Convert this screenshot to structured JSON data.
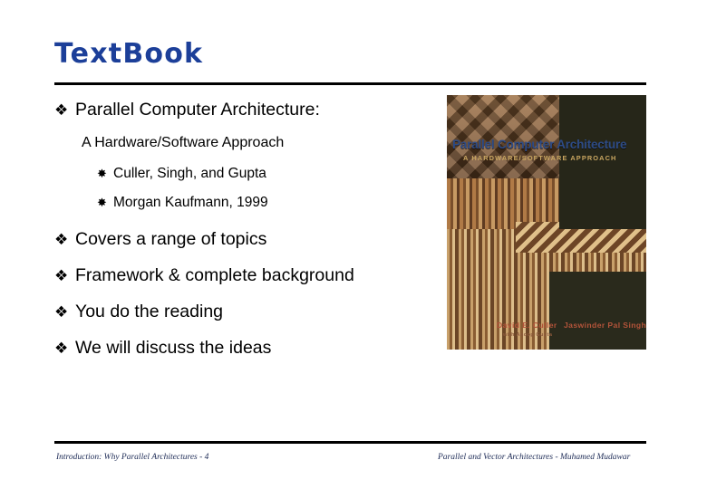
{
  "slide": {
    "title": "TextBook",
    "title_color": "#1c3f99"
  },
  "body": {
    "items": [
      {
        "level": 1,
        "glyph": "❖",
        "text": "Parallel Computer Architecture:"
      },
      {
        "level": 2,
        "glyph": "",
        "text": "A Hardware/Software Approach"
      },
      {
        "level": 3,
        "glyph": "✸",
        "text": "Culler, Singh, and Gupta"
      },
      {
        "level": 3,
        "glyph": "✸",
        "text": "Morgan Kaufmann, 1999"
      },
      {
        "level": 1,
        "glyph": "❖",
        "text": "Covers a range of topics"
      },
      {
        "level": 1,
        "glyph": "❖",
        "text": "Framework & complete background"
      },
      {
        "level": 1,
        "glyph": "❖",
        "text": "You do the reading"
      },
      {
        "level": 1,
        "glyph": "❖",
        "text": "We will discuss the ideas"
      }
    ]
  },
  "book_cover": {
    "title": "Parallel Computer Architecture",
    "subtitle": "A HARDWARE/SOFTWARE APPROACH",
    "author_left": "David E. Culler",
    "author_right": "Jaswinder Pal Singh",
    "contributor": "with Anoop Gupta"
  },
  "footer": {
    "left": "Introduction: Why Parallel Architectures - 4",
    "right": "Parallel and Vector Architectures - Muhamed Mudawar"
  }
}
